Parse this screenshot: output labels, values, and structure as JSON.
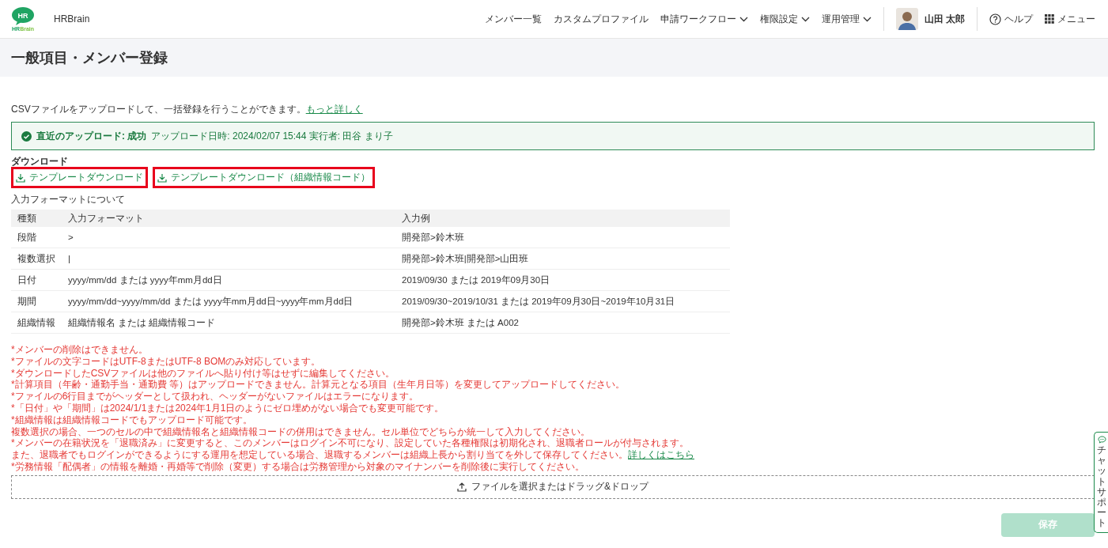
{
  "header": {
    "logo": {
      "mark": "HR",
      "wordmark_1": "HR",
      "wordmark_2": "Brain"
    },
    "app_name": "HRBrain",
    "nav": [
      {
        "label": "メンバー一覧",
        "has_menu": false
      },
      {
        "label": "カスタムプロファイル",
        "has_menu": false
      },
      {
        "label": "申請ワークフロー",
        "has_menu": true
      },
      {
        "label": "権限設定",
        "has_menu": true
      },
      {
        "label": "運用管理",
        "has_menu": true
      }
    ],
    "user": {
      "name": "山田 太郎"
    },
    "help": "ヘルプ",
    "menu": "メニュー"
  },
  "page_title": "一般項目・メンバー登録",
  "intro": {
    "text": "CSVファイルをアップロードして、一括登録を行うことができます。",
    "link": "もっと詳しく"
  },
  "upload_status": {
    "succeeded": true,
    "label": "直近のアップロード: 成功",
    "detail": "アップロード日時: 2024/02/07 15:44  実行者: 田谷 まり子"
  },
  "download": {
    "heading": "ダウンロード",
    "links": [
      {
        "label": "テンプレートダウンロード",
        "highlighted": true
      },
      {
        "label": "テンプレートダウンロード（組織情報コード）",
        "highlighted": true
      }
    ]
  },
  "format_table": {
    "caption": "入力フォーマットについて",
    "columns": [
      "種類",
      "入力フォーマット",
      "入力例"
    ],
    "rows": [
      [
        "段階",
        ">",
        "開発部>鈴木班"
      ],
      [
        "複数選択",
        "|",
        "開発部>鈴木班|開発部>山田班"
      ],
      [
        "日付",
        "yyyy/mm/dd または yyyy年mm月dd日",
        "2019/09/30 または 2019年09月30日"
      ],
      [
        "期間",
        "yyyy/mm/dd~yyyy/mm/dd または yyyy年mm月dd日~yyyy年mm月dd日",
        "2019/09/30~2019/10/31 または 2019年09月30日~2019年10月31日"
      ],
      [
        "組織情報",
        "組織情報名 または 組織情報コード",
        "開発部>鈴木班 または A002"
      ]
    ]
  },
  "notes": [
    {
      "text": "*メンバーの削除はできません。"
    },
    {
      "text": "*ファイルの文字コードはUTF-8またはUTF-8 BOMのみ対応しています。"
    },
    {
      "text": "*ダウンロードしたCSVファイルは他のファイルへ貼り付け等はせずに編集してください。"
    },
    {
      "text": "*計算項目（年齢・通勤手当・通勤費 等）はアップロードできません。計算元となる項目（生年月日等）を変更してアップロードしてください。"
    },
    {
      "text": "*ファイルの6行目までがヘッダーとして扱われ、ヘッダーがないファイルはエラーになります。"
    },
    {
      "text": "*「日付」や「期間」は2024/1/1または2024年1月1日のようにゼロ埋めがない場合でも変更可能です。"
    },
    {
      "text": "*組織情報は組織情報コードでもアップロード可能です。"
    },
    {
      "text": "複数選択の場合、一つのセルの中で組織情報名と組織情報コードの併用はできません。セル単位でどちらか統一して入力してください。"
    },
    {
      "text": "*メンバーの在籍状況を「退職済み」に変更すると、このメンバーはログイン不可になり、設定していた各種権限は初期化され、退職者ロールが付与されます。"
    },
    {
      "text": "また、退職者でもログインができるようにする運用を想定している場合、退職するメンバーは組織上長から割り当てを外して保存してください。",
      "link": "詳しくはこちら"
    },
    {
      "text": "*労務情報「配偶者」の情報を離婚・再婚等で削除（変更）する場合は労務管理から対象のマイナンバーを削除後に実行してください。"
    }
  ],
  "dropzone": {
    "label": "ファイルを選択またはドラッグ&ドロップ"
  },
  "save_button": {
    "label": "保存",
    "disabled": true
  },
  "chat_support": {
    "label": "チャットサポート"
  }
}
